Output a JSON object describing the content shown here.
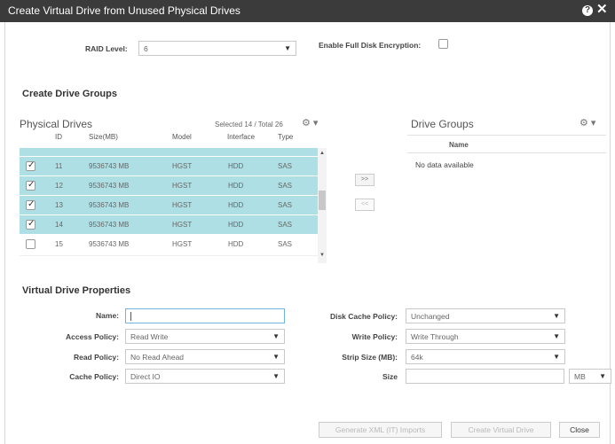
{
  "window": {
    "title": "Create Virtual Drive from Unused Physical Drives",
    "help_icon": "help-icon",
    "close_icon": "close-icon"
  },
  "raid": {
    "label": "RAID Level:",
    "value": "6"
  },
  "encryption": {
    "label": "Enable Full Disk Encryption:",
    "checked": false
  },
  "create_drive_groups": {
    "title": "Create Drive Groups"
  },
  "physical_drives": {
    "title": "Physical Drives",
    "selected_info": "Selected 14 / Total 26",
    "columns": [
      "ID",
      "Size(MB)",
      "Model",
      "Interface",
      "Type"
    ],
    "rows": [
      {
        "id": "11",
        "size": "9536743 MB",
        "model": "HGST",
        "interface": "HDD",
        "type": "SAS",
        "checked": true
      },
      {
        "id": "12",
        "size": "9536743 MB",
        "model": "HGST",
        "interface": "HDD",
        "type": "SAS",
        "checked": true
      },
      {
        "id": "13",
        "size": "9536743 MB",
        "model": "HGST",
        "interface": "HDD",
        "type": "SAS",
        "checked": true
      },
      {
        "id": "14",
        "size": "9536743 MB",
        "model": "HGST",
        "interface": "HDD",
        "type": "SAS",
        "checked": true
      },
      {
        "id": "15",
        "size": "9536743 MB",
        "model": "HGST",
        "interface": "HDD",
        "type": "SAS",
        "checked": false
      }
    ]
  },
  "move_buttons": {
    "add": ">>",
    "remove": "<<"
  },
  "drive_groups": {
    "title": "Drive Groups",
    "column": "Name",
    "empty_text": "No data available"
  },
  "vd_properties": {
    "title": "Virtual Drive Properties",
    "name_label": "Name:",
    "name_value": "",
    "access_policy_label": "Access Policy:",
    "access_policy_value": "Read Write",
    "read_policy_label": "Read Policy:",
    "read_policy_value": "No Read Ahead",
    "cache_policy_label": "Cache Policy:",
    "cache_policy_value": "Direct IO",
    "disk_cache_label": "Disk Cache Policy:",
    "disk_cache_value": "Unchanged",
    "write_policy_label": "Write Policy:",
    "write_policy_value": "Write Through",
    "strip_size_label": "Strip Size (MB):",
    "strip_size_value": "64k",
    "size_label": "Size",
    "size_value": "",
    "size_unit": "MB"
  },
  "buttons": {
    "generate": "Generate XML (IT) Imports",
    "create": "Create Virtual Drive",
    "close": "Close"
  }
}
